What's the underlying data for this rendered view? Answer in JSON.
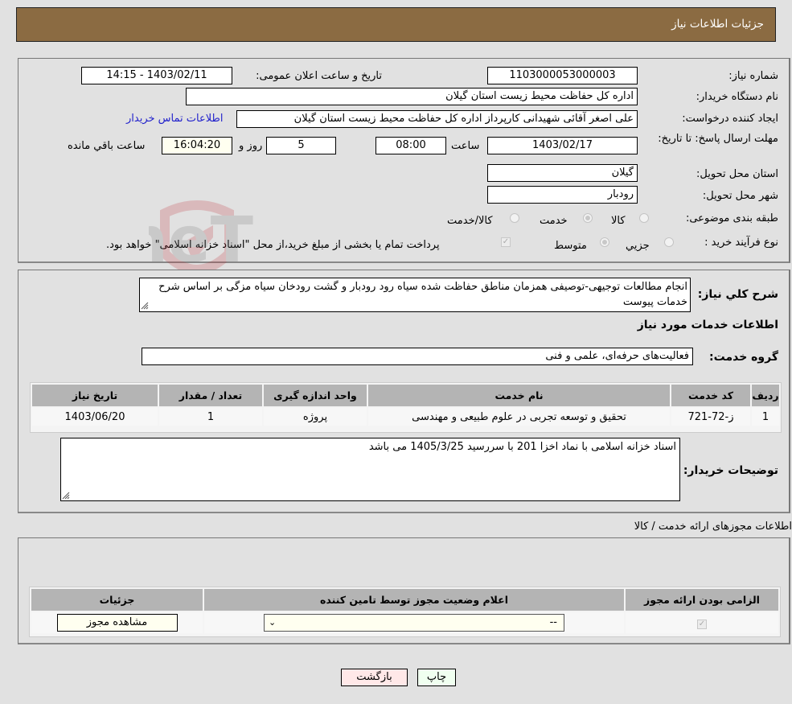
{
  "header": {
    "title": "جزئیات اطلاعات نیاز"
  },
  "form": {
    "need_number_label": "شماره نیاز:",
    "need_number": "1103000053000003",
    "announce_label": "تاریخ و ساعت اعلان عمومی:",
    "announce_value": "1403/02/11 - 14:15",
    "buyer_org_label": "نام دستگاه خریدار:",
    "buyer_org": "اداره کل حفاظت محیط زیست استان گیلان",
    "creator_label": "ایجاد کننده درخواست:",
    "creator": "علی اصغر آقائی شهیدانی کارپرداز اداره کل حفاظت محیط زیست استان گیلان",
    "contact_link": "اطلاعات تماس خریدار",
    "deadline_label": "مهلت ارسال پاسخ: تا تاریخ:",
    "deadline_date": "1403/02/17",
    "time_label": "ساعت",
    "deadline_time": "08:00",
    "days_value": "5",
    "days_label": "روز و",
    "remaining_time": "16:04:20",
    "remaining_label": "ساعت باقي مانده",
    "province_label": "استان محل تحویل:",
    "province": "گیلان",
    "city_label": "شهر محل تحویل:",
    "city": "رودبار",
    "category_label": "طبقه بندی موضوعی:",
    "category_options": [
      {
        "label": "کالا",
        "selected": false
      },
      {
        "label": "خدمت",
        "selected": true
      },
      {
        "label": "کالا/خدمت",
        "selected": false
      }
    ],
    "process_label": "نوع فرآیند خرید :",
    "process_options": [
      {
        "label": "جزیي",
        "selected": false
      },
      {
        "label": "متوسط",
        "selected": true
      }
    ],
    "treasury_checkbox_checked": true,
    "treasury_note": "پرداخت تمام یا بخشی از مبلغ خرید،از محل \"اسناد خزانه اسلامی\" خواهد بود."
  },
  "description": {
    "label": "شرح کلي نیاز:",
    "text": "انجام مطالعات توجیهی-توصیفی  همزمان مناطق حفاظت شده سیاه رود رودبار و گشت رودخان سیاه مزگی بر اساس شرح خدمات پیوست",
    "services_heading": "اطلاعات خدمات مورد نیاز",
    "service_group_label": "گروه خدمت:",
    "service_group": "فعالیت‌های حرفه‌ای، علمی و فنی"
  },
  "services_table": {
    "headers": [
      "ردیف",
      "کد خدمت",
      "نام خدمت",
      "واحد اندازه گیری",
      "تعداد / مقدار",
      "تاریخ نیاز"
    ],
    "rows": [
      [
        "1",
        "ز-72-721",
        "تحقیق و توسعه تجربی در علوم طبیعی و مهندسی",
        "پروژه",
        "1",
        "1403/06/20"
      ]
    ]
  },
  "buyer_notes": {
    "label": "توضیحات خریدار:",
    "text": "اسناد خزانه اسلامی با نماد اخزا 201 با سررسید 1405/3/25 می باشد"
  },
  "permits": {
    "heading": "اطلاعات مجوزهای ارائه خدمت / کالا",
    "headers": [
      "الزامی بودن ارائه مجوز",
      "اعلام وضعیت مجوز توسط تامین کننده",
      "جزئیات"
    ],
    "row": {
      "required_checked": true,
      "status_select": "--",
      "details_button": "مشاهده مجوز"
    }
  },
  "footer": {
    "print_button": "چاپ",
    "back_button": "بازگشت"
  },
  "colors": {
    "header_bg": "#8b6b42",
    "print_bg": "#f0fff0",
    "back_bg": "#ffe8e8",
    "yellow_field": "#fffff0"
  }
}
